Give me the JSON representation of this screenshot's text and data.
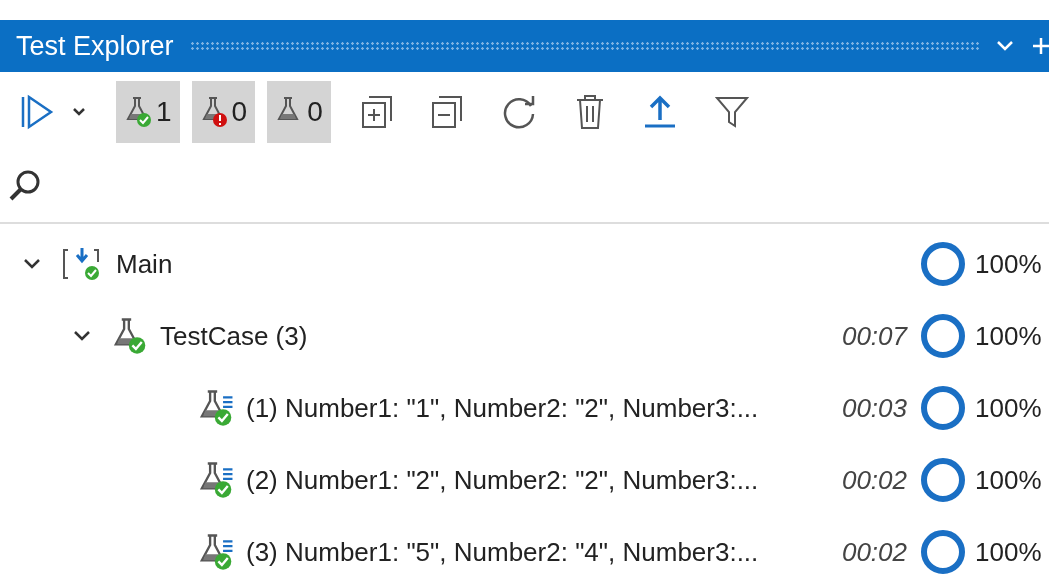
{
  "window": {
    "title": "Test Explorer"
  },
  "toolbar": {
    "filters": [
      {
        "kind": "passed",
        "count": "1",
        "on": true
      },
      {
        "kind": "failed",
        "count": "0",
        "on": true
      },
      {
        "kind": "not_run",
        "count": "0",
        "on": true
      }
    ]
  },
  "tree": [
    {
      "kind": "project",
      "label": "Main",
      "expanded": true,
      "coverage": "100%",
      "children": [
        {
          "kind": "test",
          "label": "TestCase (3)",
          "expanded": true,
          "duration": "00:07",
          "coverage": "100%",
          "children": [
            {
              "kind": "case",
              "label": "(1) Number1: \"1\", Number2: \"2\", Number3:...",
              "duration": "00:03",
              "coverage": "100%"
            },
            {
              "kind": "case",
              "label": "(2) Number1: \"2\", Number2: \"2\", Number3:...",
              "duration": "00:02",
              "coverage": "100%"
            },
            {
              "kind": "case",
              "label": "(3) Number1: \"5\", Number2: \"4\", Number3:...",
              "duration": "00:02",
              "coverage": "100%"
            }
          ]
        }
      ]
    }
  ]
}
